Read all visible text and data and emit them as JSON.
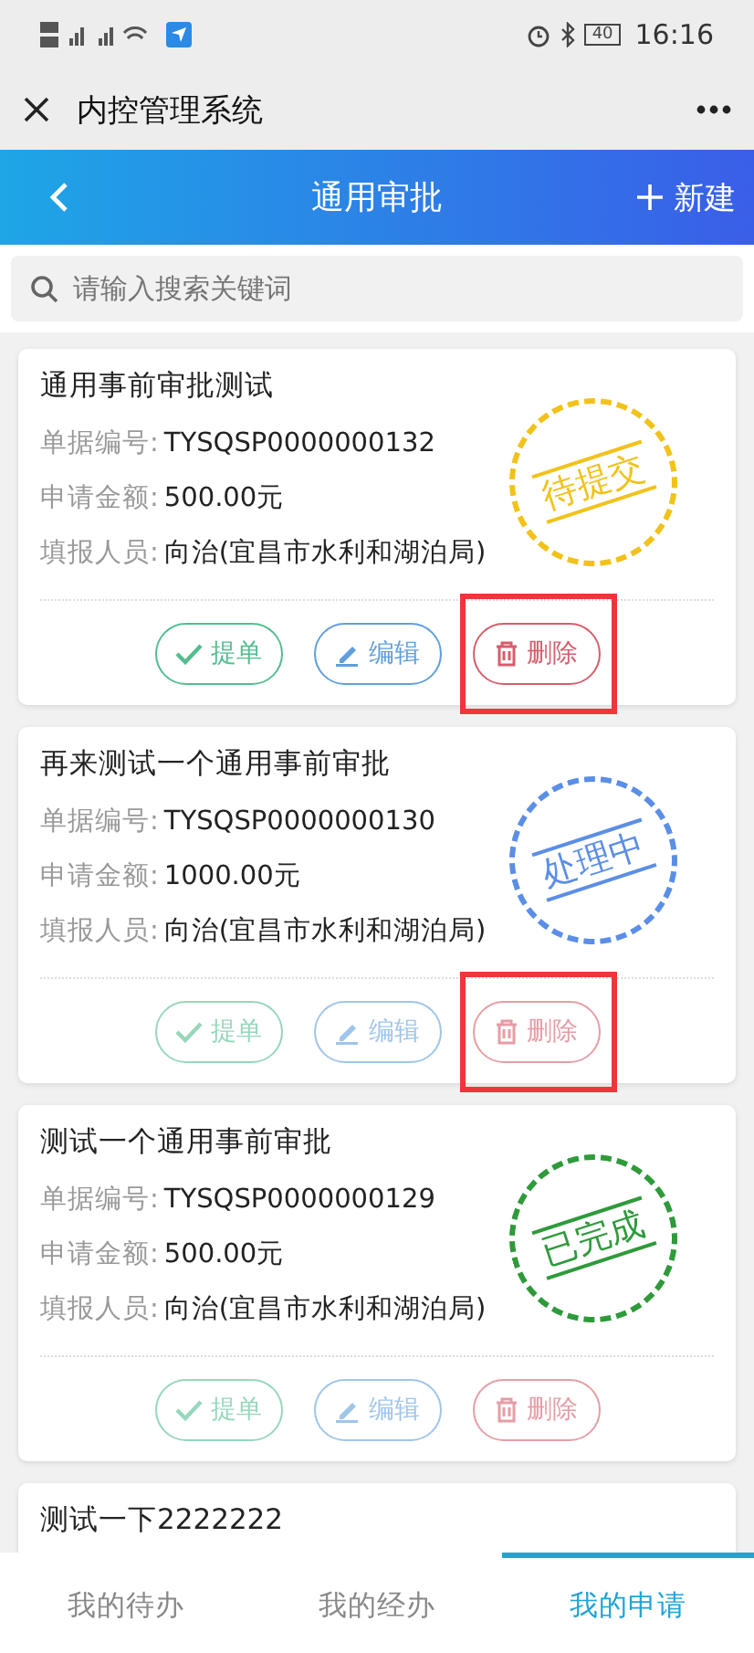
{
  "status_bar": {
    "time": "16:16",
    "battery": "40"
  },
  "app_bar": {
    "title": "内控管理系统"
  },
  "header": {
    "title": "通用审批",
    "new_label": "新建"
  },
  "search": {
    "placeholder": "请输入搜索关键词"
  },
  "cards": [
    {
      "title": "通用事前审批测试",
      "fields": [
        {
          "label": "单据编号:",
          "value": "TYSQSP0000000132"
        },
        {
          "label": "申请金额:",
          "value": "500.00元"
        },
        {
          "label": "填报人员:",
          "value": "向治(宜昌市水利和湖泊局)"
        }
      ],
      "stamp": {
        "text": "待提交",
        "color": "#f2c21a"
      },
      "actions": [
        {
          "kind": "submit",
          "label": "提单",
          "disabled": false
        },
        {
          "kind": "edit",
          "label": "编辑",
          "disabled": false
        },
        {
          "kind": "delete",
          "label": "删除",
          "disabled": false,
          "highlighted": true
        }
      ]
    },
    {
      "title": "再来测试一个通用事前审批",
      "fields": [
        {
          "label": "单据编号:",
          "value": "TYSQSP0000000130"
        },
        {
          "label": "申请金额:",
          "value": "1000.00元"
        },
        {
          "label": "填报人员:",
          "value": "向治(宜昌市水利和湖泊局)"
        }
      ],
      "stamp": {
        "text": "处理中",
        "color": "#5b8ee6"
      },
      "actions": [
        {
          "kind": "submit",
          "label": "提单",
          "disabled": true
        },
        {
          "kind": "edit",
          "label": "编辑",
          "disabled": true
        },
        {
          "kind": "delete",
          "label": "删除",
          "disabled": true,
          "highlighted": true
        }
      ]
    },
    {
      "title": "测试一个通用事前审批",
      "fields": [
        {
          "label": "单据编号:",
          "value": "TYSQSP0000000129"
        },
        {
          "label": "申请金额:",
          "value": "500.00元"
        },
        {
          "label": "填报人员:",
          "value": "向治(宜昌市水利和湖泊局)"
        }
      ],
      "stamp": {
        "text": "已完成",
        "color": "#2e9a3a"
      },
      "actions": [
        {
          "kind": "submit",
          "label": "提单",
          "disabled": true
        },
        {
          "kind": "edit",
          "label": "编辑",
          "disabled": true
        },
        {
          "kind": "delete",
          "label": "删除",
          "disabled": true,
          "highlighted": false
        }
      ]
    },
    {
      "title": "测试一下2222222"
    }
  ],
  "tabs": [
    {
      "label": "我的待办",
      "selected": false
    },
    {
      "label": "我的经办",
      "selected": false
    },
    {
      "label": "我的申请",
      "selected": true
    }
  ]
}
